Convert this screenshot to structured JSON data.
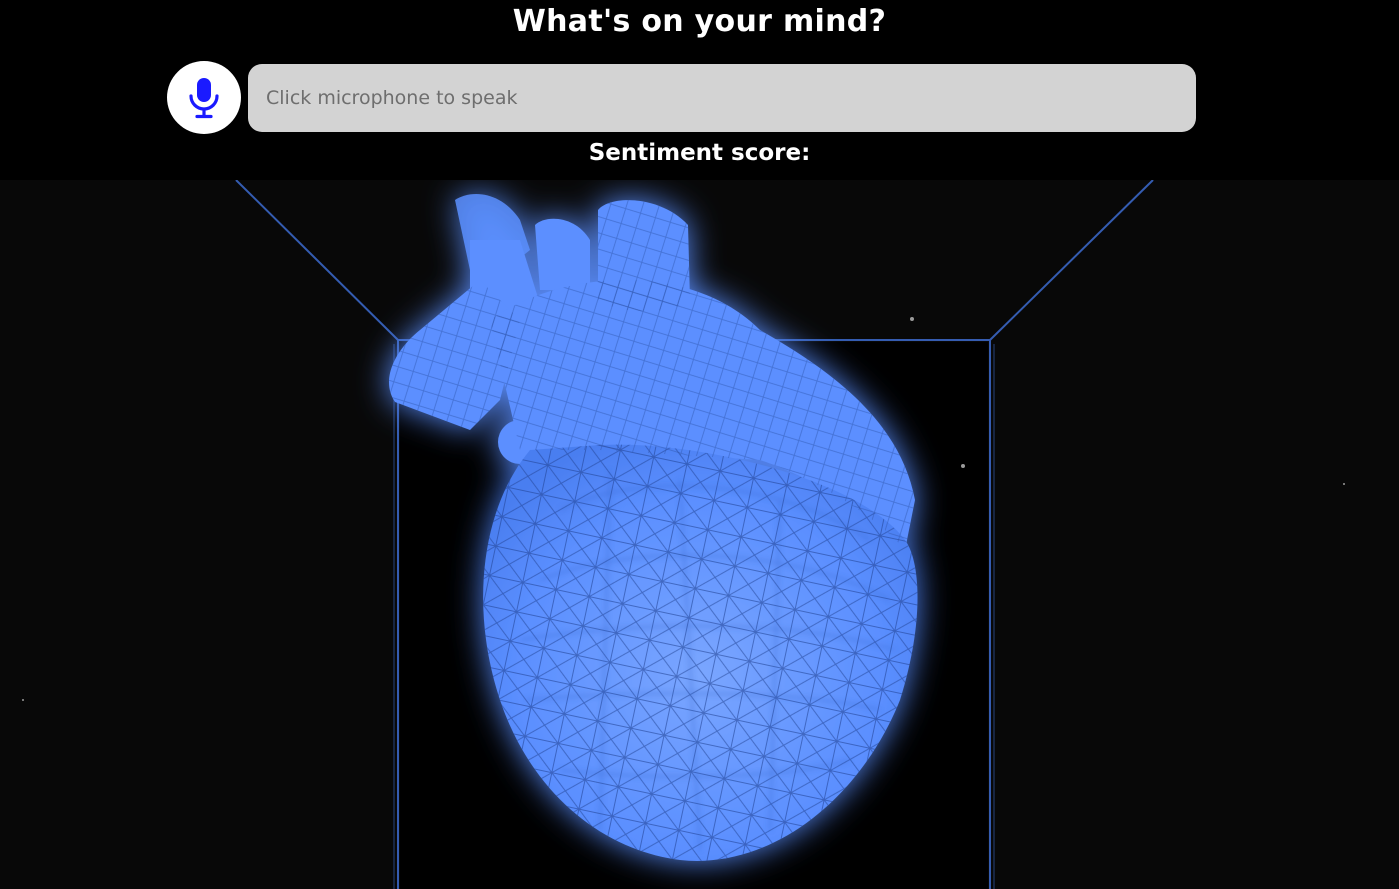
{
  "header": {
    "title": "What's on your mind?",
    "mic_icon": "microphone-icon",
    "accent_color": "#1a1aff"
  },
  "search": {
    "placeholder": "Click microphone to speak",
    "value": ""
  },
  "sentiment": {
    "label": "Sentiment score:",
    "value": ""
  },
  "scene": {
    "hologram_color": "#5b8fff",
    "room_line_color": "#3a66c4"
  }
}
